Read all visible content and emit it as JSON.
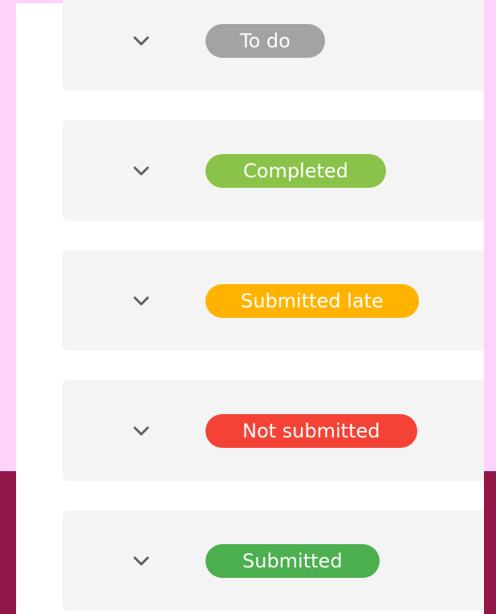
{
  "colors": {
    "page_bg_top": "#fdd2fb",
    "page_bg_bottom": "#921648",
    "panel_bg": "#ffffff",
    "row_bg": "#f4f4f4",
    "chevron": "#606060"
  },
  "status_rows": [
    {
      "label": "To do",
      "color": "#a3a3a3",
      "icon": "chevron-down-icon"
    },
    {
      "label": "Completed",
      "color": "#8bc34a",
      "icon": "chevron-down-icon"
    },
    {
      "label": "Submitted late",
      "color": "#ffb300",
      "icon": "chevron-down-icon"
    },
    {
      "label": "Not submitted",
      "color": "#f44336",
      "icon": "chevron-down-icon"
    },
    {
      "label": "Submitted",
      "color": "#4caf50",
      "icon": "chevron-down-icon"
    }
  ]
}
